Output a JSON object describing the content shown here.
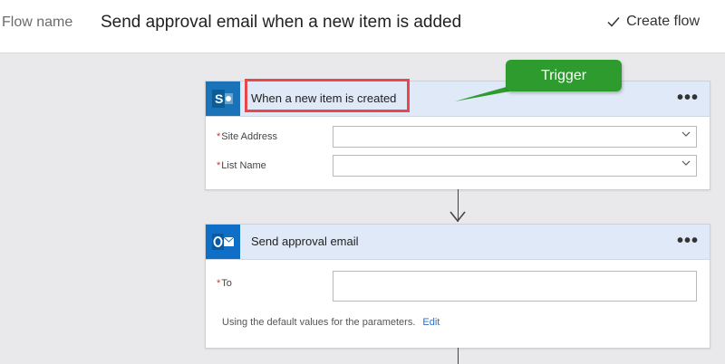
{
  "header": {
    "flow_label": "Flow name",
    "flow_title": "Send approval email when a new item is added",
    "create_label": "Create flow"
  },
  "trigger_card": {
    "title": "When a new item is created",
    "icon": "sharepoint-icon",
    "fields": [
      {
        "label": "Site Address",
        "required": true,
        "value": ""
      },
      {
        "label": "List Name",
        "required": true,
        "value": ""
      }
    ]
  },
  "action_card": {
    "title": "Send approval email",
    "icon": "outlook-icon",
    "to_label": "To",
    "to_value": "",
    "hint": "Using the default values for the parameters.",
    "edit_label": "Edit"
  },
  "callout": {
    "label": "Trigger",
    "color": "#2e9b2e"
  },
  "colors": {
    "highlight": "#e8474b",
    "card_header": "#dfe9f7",
    "brand_blue": "#0f6fc6"
  }
}
